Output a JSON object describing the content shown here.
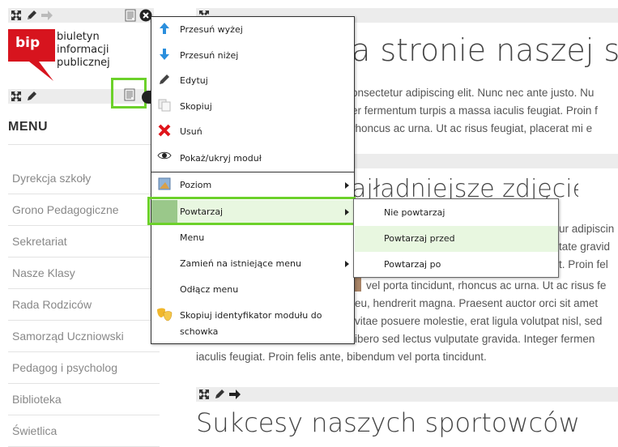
{
  "logo": {
    "short": "bip",
    "line1": "biuletyn",
    "line2": "informacji publicznej"
  },
  "menu": {
    "heading": "MENU",
    "items": [
      "Dyrekcja szkoły",
      "Grono Pedagogiczne",
      "Sekretariat",
      "Nasze Klasy",
      "Rada Rodziców",
      "Samorząd Uczniowski",
      "Pedagog i psycholog",
      "Biblioteka",
      "Świetlica"
    ]
  },
  "content": {
    "title1": "a stronie naszej sz",
    "para1": [
      "onsectetur adipiscing elit. Nunc nec ante justo. Nu",
      "er fermentum turpis a massa iaculis feugiat. Proin f",
      "rhoncus ac urna. Ut ac risus feugiat, placerat mi e"
    ],
    "title2": "ajładniejsze zdjęcie",
    "para2_right": [
      "ur adipiscin",
      "tate gravid",
      "t. Proin fel"
    ],
    "para3": [
      "vel porta tincidunt, rhoncus ac urna. Ut ac risus fe",
      "eu, hendrerit magna. Praesent auctor orci sit amet",
      "vitae posuere molestie, erat ligula volutpat nisl, sed",
      "ibero sed lectus vulputate gravida. Integer fermen",
      "iaculis feugiat. Proin felis ante, bibendum vel porta tincidunt."
    ],
    "title3": "Sukcesy naszych sportowców"
  },
  "context_menu": {
    "items": [
      {
        "label": "Przesuń wyżej",
        "icon": "arrow-up-icon"
      },
      {
        "label": "Przesuń niżej",
        "icon": "arrow-down-icon"
      },
      {
        "label": "Edytuj",
        "icon": "pencil-icon"
      },
      {
        "label": "Skopiuj",
        "icon": "copy-icon"
      },
      {
        "label": "Usuń",
        "icon": "delete-icon"
      },
      {
        "label": "Pokaż/ukryj moduł",
        "icon": "eye-icon"
      },
      {
        "label": "Poziom",
        "icon": "level-icon"
      },
      {
        "label": "Powtarzaj",
        "icon": "repeat-icon"
      },
      {
        "label": "Menu",
        "icon": ""
      },
      {
        "label": "Zamień na istniejące menu",
        "icon": ""
      },
      {
        "label": "Odłącz menu",
        "icon": ""
      },
      {
        "label": "Skopiuj identyfikator modułu do schowka",
        "icon": "masks-icon"
      }
    ]
  },
  "submenu": {
    "items": [
      "Nie powtarzaj",
      "Powtarzaj przed",
      "Powtarzaj po"
    ]
  },
  "colors": {
    "highlight_green": "#6cd12a",
    "selected_bg": "#e8f7e0",
    "bip_red": "#d7141e"
  }
}
